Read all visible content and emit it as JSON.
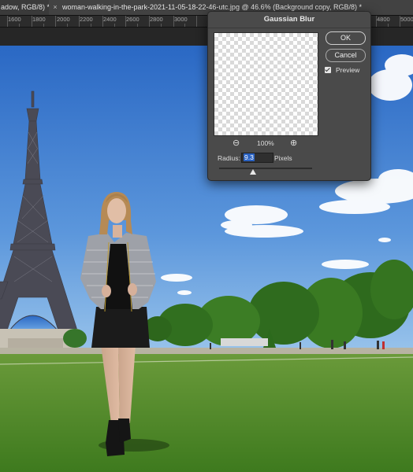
{
  "tabs": {
    "tab1_label": "adow, RGB/8) *",
    "tab2_close": "×",
    "tab2_label": "woman-walking-in-the-park-2021-11-05-18-22-46-utc.jpg @ 46.6% (Background copy, RGB/8) *"
  },
  "ruler": {
    "ticks": [
      "1600",
      "1800",
      "2000",
      "2200",
      "2400",
      "2600",
      "2800",
      "3000",
      "4800",
      "5000"
    ]
  },
  "dialog": {
    "title": "Gaussian Blur",
    "ok_label": "OK",
    "cancel_label": "Cancel",
    "preview_label": "Preview",
    "preview_checked": true,
    "zoom_out_icon": "zoom-out-icon",
    "zoom_in_icon": "zoom-in-icon",
    "zoom_level": "100%",
    "radius_label": "Radius:",
    "radius_value": "9.3",
    "radius_unit": "Pixels"
  },
  "colors": {
    "sky_top": "#2f6fc9",
    "sky_bottom": "#86b6e6",
    "grass": "#4f8a2a",
    "dialog_bg": "#4a4a4a",
    "selection": "#2a62c2"
  }
}
